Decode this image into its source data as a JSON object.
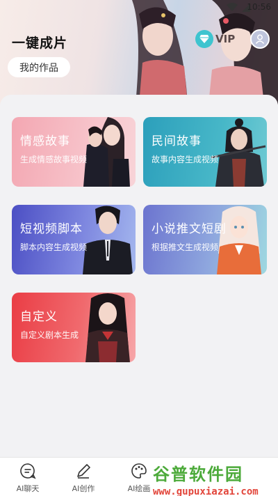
{
  "status_bar": {
    "time": "10:56"
  },
  "header": {
    "title": "一键成片",
    "my_works_label": "我的作品",
    "vip_label": "VIP"
  },
  "cards": [
    {
      "title": "情感故事",
      "subtitle": "生成情感故事视频",
      "icon": "couple-illustration"
    },
    {
      "title": "民间故事",
      "subtitle": "故事内容生成视频",
      "icon": "warrior-illustration"
    },
    {
      "title": "短视频脚本",
      "subtitle": "脚本内容生成视频",
      "icon": "businessman-illustration"
    },
    {
      "title": "小说推文短剧",
      "subtitle": "根据推文生成视频",
      "icon": "anime-girl-illustration"
    },
    {
      "title": "自定义",
      "subtitle": "自定义剧本生成",
      "icon": "schoolgirl-illustration"
    }
  ],
  "nav": [
    {
      "label": "AI聊天",
      "icon": "chat-icon"
    },
    {
      "label": "AI创作",
      "icon": "pen-icon"
    },
    {
      "label": "AI绘画",
      "icon": "palette-icon"
    }
  ],
  "watermark": {
    "top": "谷普软件园",
    "bottom": "www.gupuxiazai.com"
  },
  "colors": {
    "card1": "#f3a7b2",
    "card2": "#2c9fbb",
    "card3": "#4c4fc4",
    "card4": "#6c74cf",
    "card5": "#ea3d45",
    "vip": "#3ec4cf"
  }
}
